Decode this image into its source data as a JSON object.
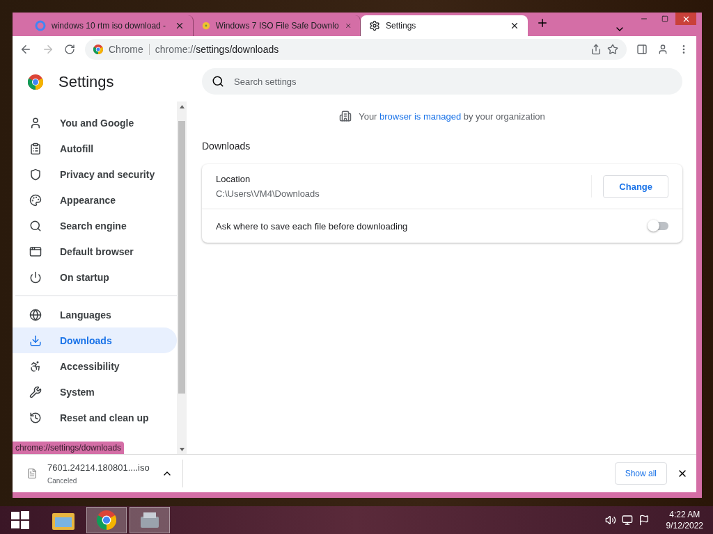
{
  "tabs": [
    {
      "title": "windows 10 rtm iso download -",
      "selected": false
    },
    {
      "title": "Windows 7 ISO File Safe Downlo",
      "selected": false
    },
    {
      "title": "Settings",
      "selected": true
    }
  ],
  "omnibox": {
    "chip": "Chrome",
    "url_host": "chrome://",
    "url_path": "settings/downloads"
  },
  "settings": {
    "title": "Settings",
    "search_placeholder": "Search settings",
    "sidebar": {
      "groups": [
        [
          {
            "label": "You and Google",
            "selected": false
          },
          {
            "label": "Autofill",
            "selected": false
          },
          {
            "label": "Privacy and security",
            "selected": false
          },
          {
            "label": "Appearance",
            "selected": false
          },
          {
            "label": "Search engine",
            "selected": false
          },
          {
            "label": "Default browser",
            "selected": false
          },
          {
            "label": "On startup",
            "selected": false
          }
        ],
        [
          {
            "label": "Languages",
            "selected": false
          },
          {
            "label": "Downloads",
            "selected": true
          },
          {
            "label": "Accessibility",
            "selected": false
          },
          {
            "label": "System",
            "selected": false
          },
          {
            "label": "Reset and clean up",
            "selected": false
          }
        ]
      ]
    },
    "managed_notice": "Your **browser is managed** by your organization",
    "section_title": "Downloads",
    "location": {
      "label": "Location",
      "path": "C:\\Users\\VM4\\Downloads",
      "button": "Change"
    },
    "ask_toggle": {
      "label": "Ask where to save each file before downloading",
      "on": false
    }
  },
  "status_bubble": "chrome://settings/downloads",
  "download_shelf": {
    "file": "7601.24214.180801....iso",
    "status": "Canceled",
    "show_all": "Show all"
  },
  "taskbar": {
    "time": "4:22 AM",
    "date": "9/12/2022"
  }
}
